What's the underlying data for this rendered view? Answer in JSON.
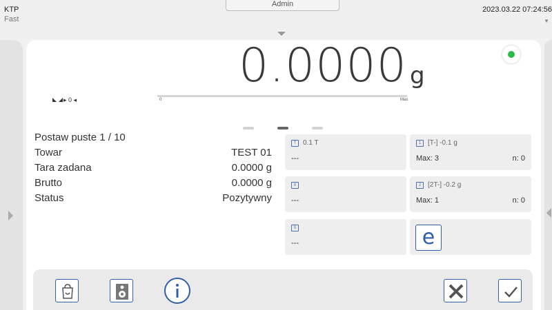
{
  "status_bar": {
    "mode": "KTP",
    "speed": "Fast",
    "user": "Admin",
    "datetime": "2023.03.22 07:24:56"
  },
  "display": {
    "weight": "0.0000",
    "unit": "g",
    "zero_indicator": "▸ 0 ◂",
    "bar_min": "0",
    "bar_max": "Max",
    "bar_fill_fraction": 0.0,
    "stable_color": "#2fb84a"
  },
  "info_rows": [
    {
      "label": "Postaw puste 1 / 10",
      "value": ""
    },
    {
      "label": "Towar",
      "value": "TEST 01"
    },
    {
      "label": "Tara zadana",
      "value": "0.0000 g"
    },
    {
      "label": "Brutto",
      "value": "0.0000 g"
    },
    {
      "label": "Status",
      "value": "Pozytywny"
    }
  ],
  "tiles": {
    "tare": {
      "icon": "tare-icon",
      "title": "0.1 T",
      "value": "---"
    },
    "t_minus": {
      "icon": "threshold-icon",
      "title": "[T-]  -0.1 g",
      "max": "Max: 3",
      "n": "n: 0"
    },
    "mean": {
      "icon": "x-mean-icon",
      "title": "",
      "value": "---"
    },
    "t2_minus": {
      "icon": "threshold-2-icon",
      "title": "[2T-]  -0.2 g",
      "max": "Max: 1",
      "n": "n: 0"
    },
    "stddev": {
      "icon": "s-icon",
      "title": "",
      "value": "---"
    },
    "e_button": {
      "icon": "e-icon",
      "label": "e"
    }
  },
  "toolbar": {
    "buttons": [
      "bag-icon",
      "weight-settings-icon",
      "info-icon",
      "cancel-icon",
      "confirm-icon"
    ]
  },
  "colors": {
    "accent": "#2f5fa8",
    "panel": "#ffffff",
    "background": "#f1f1f1"
  }
}
